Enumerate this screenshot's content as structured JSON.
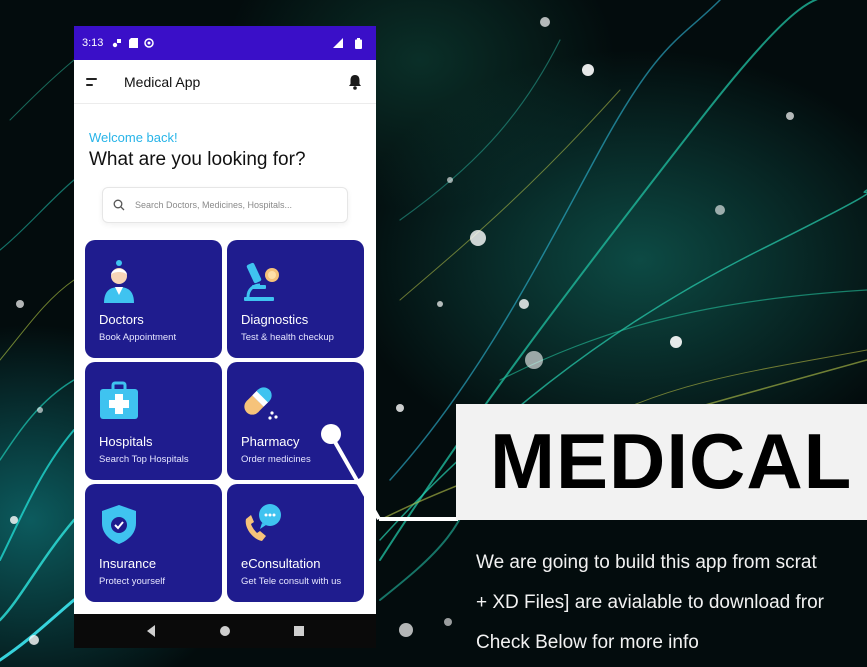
{
  "status_bar": {
    "time": "3:13"
  },
  "app_bar": {
    "title": "Medical App"
  },
  "greeting": {
    "welcome": "Welcome back!",
    "question": "What are you looking for?"
  },
  "search": {
    "placeholder": "Search Doctors, Medicines, Hospitals..."
  },
  "categories": [
    {
      "name": "Doctors",
      "subtitle": "Book Appointment",
      "icon": "doctor-icon"
    },
    {
      "name": "Diagnostics",
      "subtitle": "Test & health checkup",
      "icon": "microscope-icon"
    },
    {
      "name": "Hospitals",
      "subtitle": "Search Top Hospitals",
      "icon": "hospital-icon"
    },
    {
      "name": "Pharmacy",
      "subtitle": "Order medicines",
      "icon": "pill-icon"
    },
    {
      "name": "Insurance",
      "subtitle": "Protect yourself",
      "icon": "shield-icon"
    },
    {
      "name": "eConsultation",
      "subtitle": "Get Tele consult with us",
      "icon": "phone-chat-icon"
    }
  ],
  "nav_bar": {
    "back": "back-icon",
    "home": "home-icon",
    "recents": "recents-icon"
  },
  "banner": {
    "text": "MEDICAL"
  },
  "caption_lines": [
    "We are going to build this app from scrat",
    "+ XD Files] are avialable to download fror",
    "Check Below for more info"
  ],
  "colors": {
    "status_bar": "#3a0fc8",
    "card": "#1f1c8e",
    "welcome": "#27b4e8",
    "accent_cyan": "#3fc3f0"
  }
}
